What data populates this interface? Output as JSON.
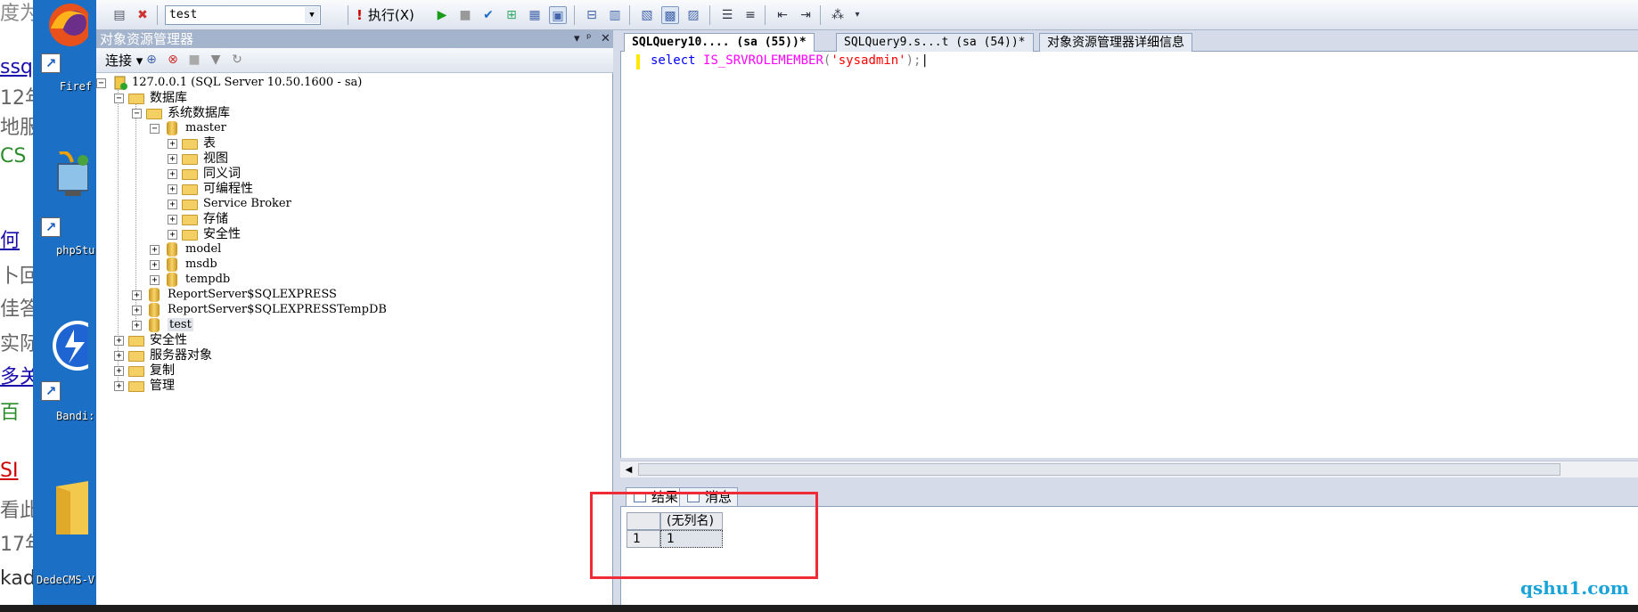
{
  "background_page": {
    "lines": [
      "度为",
      "ssq",
      "12年",
      "地服",
      "CS",
      "何",
      "卜回答",
      "佳答",
      "实际",
      "多关",
      "百",
      "SI",
      "看此",
      "17年",
      "kad"
    ]
  },
  "desktop": {
    "icons": [
      {
        "label": "Firef",
        "icon": "firefox-icon"
      },
      {
        "label": "phpStu",
        "icon": "computer-icon"
      },
      {
        "label": "Bandi:",
        "icon": "bandizip-icon"
      },
      {
        "label": "DedeCMS-V",
        "icon": "folder-icon"
      }
    ]
  },
  "toolbar": {
    "database": "test",
    "execute_label": "执行(X)"
  },
  "object_explorer": {
    "title": "对象资源管理器",
    "pin": "▾ ᵖ ✕",
    "connect_label": "连接",
    "tree": {
      "server": "127.0.0.1 (SQL Server 10.50.1600 - sa)",
      "databases": "数据库",
      "system_databases": "系统数据库",
      "master": "master",
      "master_children": [
        "表",
        "视图",
        "同义词",
        "可编程性",
        "Service Broker",
        "存储",
        "安全性"
      ],
      "model": "model",
      "msdb": "msdb",
      "tempdb": "tempdb",
      "user_databases": [
        "ReportServer$SQLEXPRESS",
        "ReportServer$SQLEXPRESSTempDB",
        "test"
      ],
      "root_items": [
        "安全性",
        "服务器对象",
        "复制",
        "管理"
      ]
    }
  },
  "editor": {
    "tabs": [
      {
        "label": "SQLQuery10.... (sa (55))*",
        "active": true
      },
      {
        "label": "SQLQuery9.s...t (sa (54))*",
        "active": false
      },
      {
        "label": "对象资源管理器详细信息",
        "active": false
      }
    ],
    "code": {
      "kw": "select",
      "fn": "IS_SRVROLEMEMBER",
      "open": "(",
      "arg": "'sysadmin'",
      "close": ");"
    }
  },
  "results": {
    "tabs": [
      "结果",
      "消息"
    ],
    "column_header": "(无列名)",
    "row_number": "1",
    "value": "1"
  },
  "watermark": "qshu1.com",
  "colors": {
    "highlight_box": "#ee2b36",
    "keyword": "#0000ff",
    "function": "#ff00ff",
    "string": "#ff0000",
    "watermark": "#1aa3d9"
  }
}
